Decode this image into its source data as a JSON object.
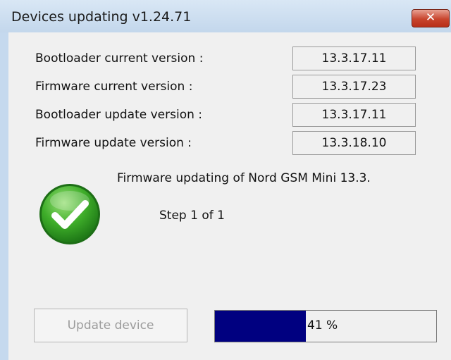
{
  "window": {
    "title": "Devices updating v1.24.71",
    "close_label": "✕"
  },
  "versions": [
    {
      "label": "Bootloader current version :",
      "value": "13.3.17.11"
    },
    {
      "label": "Firmware current version :",
      "value": "13.3.17.23"
    },
    {
      "label": "Bootloader update version :",
      "value": "13.3.17.11"
    },
    {
      "label": "Firmware update version :",
      "value": "13.3.18.10"
    }
  ],
  "status": {
    "message": "Firmware updating of Nord GSM Mini 13.3.",
    "step": "Step 1 of 1",
    "icon": "check-circle-icon",
    "icon_color": "#3fae2a"
  },
  "update_button": {
    "label": "Update device",
    "enabled": false
  },
  "progress": {
    "percent": 41,
    "text": "41 %",
    "fill_color": "#000080"
  }
}
